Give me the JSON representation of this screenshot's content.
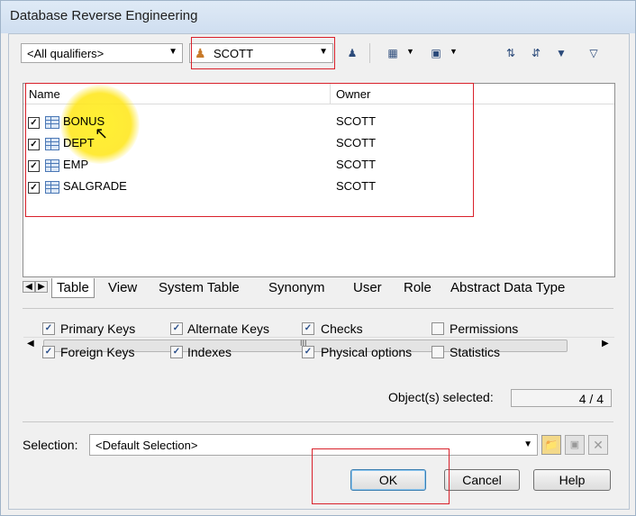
{
  "window": {
    "title": "Database Reverse Engineering"
  },
  "toolbar": {
    "qualifier_combo": "<All qualifiers>",
    "owner_combo": "SCOTT",
    "owner_icon": "user-icon",
    "tool_icons": [
      "select-owner-icon",
      "select-all-icon",
      "deselect-all-icon",
      "move-up-icon",
      "move-down-icon",
      "filter-icon",
      "clear-filter-icon"
    ]
  },
  "list": {
    "columns": [
      "Name",
      "Owner"
    ],
    "rows": [
      {
        "name": "BONUS",
        "owner": "SCOTT",
        "checked": true
      },
      {
        "name": "DEPT",
        "owner": "SCOTT",
        "checked": true
      },
      {
        "name": "EMP",
        "owner": "SCOTT",
        "checked": true
      },
      {
        "name": "SALGRADE",
        "owner": "SCOTT",
        "checked": true
      }
    ],
    "scroll_glyph": "III"
  },
  "tabs": [
    "Table",
    "View",
    "System Table",
    "Synonym",
    "User",
    "Role",
    "Abstract Data Type"
  ],
  "options": {
    "primary_keys": "Primary Keys",
    "foreign_keys": "Foreign Keys",
    "alternate_keys": "Alternate Keys",
    "indexes": "Indexes",
    "checks": "Checks",
    "physical_options": "Physical options",
    "permissions": "Permissions",
    "statistics": "Statistics"
  },
  "status": {
    "label": "Object(s) selected:",
    "value": "4 / 4"
  },
  "selection": {
    "label": "Selection:",
    "value": "<Default Selection>"
  },
  "buttons": {
    "ok": "OK",
    "cancel": "Cancel",
    "help": "Help"
  },
  "colors": {
    "annotation_red": "#d9212b",
    "highlight_yellow": "#ffe61e"
  }
}
